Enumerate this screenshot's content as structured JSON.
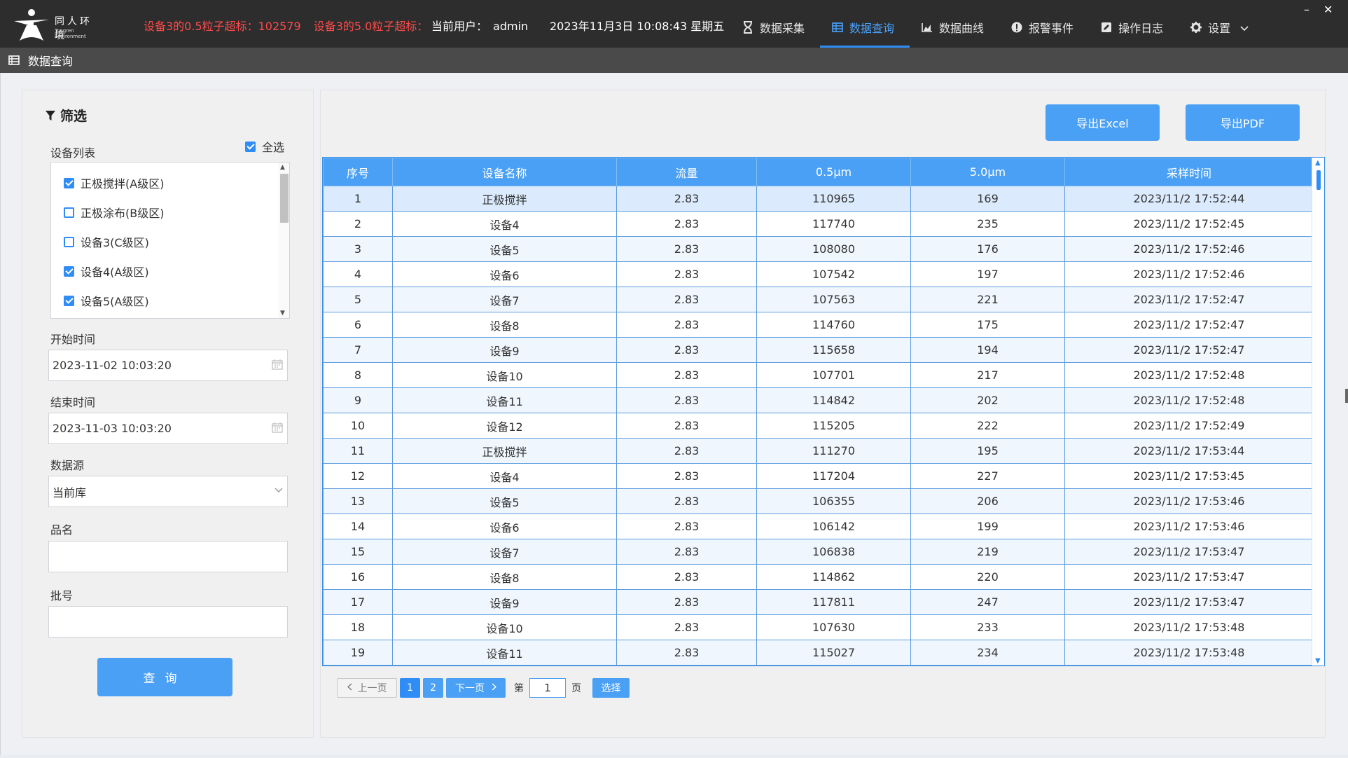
{
  "brand": {
    "cn": "同人环境",
    "en": "Tongren Environment"
  },
  "alerts": [
    "设备3的0.5粒子超标：102579",
    "设备3的5.0粒子超标："
  ],
  "user": {
    "label": "当前用户：",
    "name": "admin"
  },
  "datetime": "2023年11月3日 10:08:43 星期五",
  "nav": [
    {
      "label": "数据采集",
      "icon": "hourglass-icon"
    },
    {
      "label": "数据查询",
      "icon": "table-icon"
    },
    {
      "label": "数据曲线",
      "icon": "area-chart-icon"
    },
    {
      "label": "报警事件",
      "icon": "alert-circle-icon"
    },
    {
      "label": "操作日志",
      "icon": "edit-icon"
    },
    {
      "label": "设置",
      "icon": "gear-icon"
    }
  ],
  "window": {
    "minimize": "–",
    "close": "✕"
  },
  "page_title": "数据查询",
  "filter": {
    "title": "筛选",
    "device_list_label": "设备列表",
    "select_all_label": "全选",
    "select_all_checked": true,
    "devices": [
      {
        "label": "正极搅拌(A级区)",
        "checked": true
      },
      {
        "label": "正极涂布(B级区)",
        "checked": false
      },
      {
        "label": "设备3(C级区)",
        "checked": false
      },
      {
        "label": "设备4(A级区)",
        "checked": true
      },
      {
        "label": "设备5(A级区)",
        "checked": true
      }
    ],
    "start_label": "开始时间",
    "start_value": "2023-11-02 10:03:20",
    "end_label": "结束时间",
    "end_value": "2023-11-03 10:03:20",
    "source_label": "数据源",
    "source_value": "当前库",
    "product_label": "品名",
    "product_value": "",
    "batch_label": "批号",
    "batch_value": "",
    "query_label": "查询"
  },
  "export": {
    "excel": "导出Excel",
    "pdf": "导出PDF"
  },
  "table": {
    "columns": [
      "序号",
      "设备名称",
      "流量",
      "0.5μm",
      "5.0μm",
      "采样时间"
    ],
    "rows": [
      [
        "1",
        "正极搅拌",
        "2.83",
        "110965",
        "169",
        "2023/11/2 17:52:44"
      ],
      [
        "2",
        "设备4",
        "2.83",
        "117740",
        "235",
        "2023/11/2 17:52:45"
      ],
      [
        "3",
        "设备5",
        "2.83",
        "108080",
        "176",
        "2023/11/2 17:52:46"
      ],
      [
        "4",
        "设备6",
        "2.83",
        "107542",
        "197",
        "2023/11/2 17:52:46"
      ],
      [
        "5",
        "设备7",
        "2.83",
        "107563",
        "221",
        "2023/11/2 17:52:47"
      ],
      [
        "6",
        "设备8",
        "2.83",
        "114760",
        "175",
        "2023/11/2 17:52:47"
      ],
      [
        "7",
        "设备9",
        "2.83",
        "115658",
        "194",
        "2023/11/2 17:52:47"
      ],
      [
        "8",
        "设备10",
        "2.83",
        "107701",
        "217",
        "2023/11/2 17:52:48"
      ],
      [
        "9",
        "设备11",
        "2.83",
        "114842",
        "202",
        "2023/11/2 17:52:48"
      ],
      [
        "10",
        "设备12",
        "2.83",
        "115205",
        "222",
        "2023/11/2 17:52:49"
      ],
      [
        "11",
        "正极搅拌",
        "2.83",
        "111270",
        "195",
        "2023/11/2 17:53:44"
      ],
      [
        "12",
        "设备4",
        "2.83",
        "117204",
        "227",
        "2023/11/2 17:53:45"
      ],
      [
        "13",
        "设备5",
        "2.83",
        "106355",
        "206",
        "2023/11/2 17:53:46"
      ],
      [
        "14",
        "设备6",
        "2.83",
        "106142",
        "199",
        "2023/11/2 17:53:46"
      ],
      [
        "15",
        "设备7",
        "2.83",
        "106838",
        "219",
        "2023/11/2 17:53:47"
      ],
      [
        "16",
        "设备8",
        "2.83",
        "114862",
        "220",
        "2023/11/2 17:53:47"
      ],
      [
        "17",
        "设备9",
        "2.83",
        "117811",
        "247",
        "2023/11/2 17:53:47"
      ],
      [
        "18",
        "设备10",
        "2.83",
        "107630",
        "233",
        "2023/11/2 17:53:48"
      ],
      [
        "19",
        "设备11",
        "2.83",
        "115027",
        "234",
        "2023/11/2 17:53:48"
      ]
    ],
    "selected_row": 0
  },
  "pager": {
    "prev": "上一页",
    "pages": [
      "1",
      "2"
    ],
    "current": "1",
    "next": "下一页",
    "page_prefix": "第",
    "page_input": "1",
    "page_suffix": "页",
    "go": "选择"
  },
  "colors": {
    "accent": "#4aa0f5",
    "alert": "#ff4a4a",
    "topbar": "#2d2d2d"
  }
}
